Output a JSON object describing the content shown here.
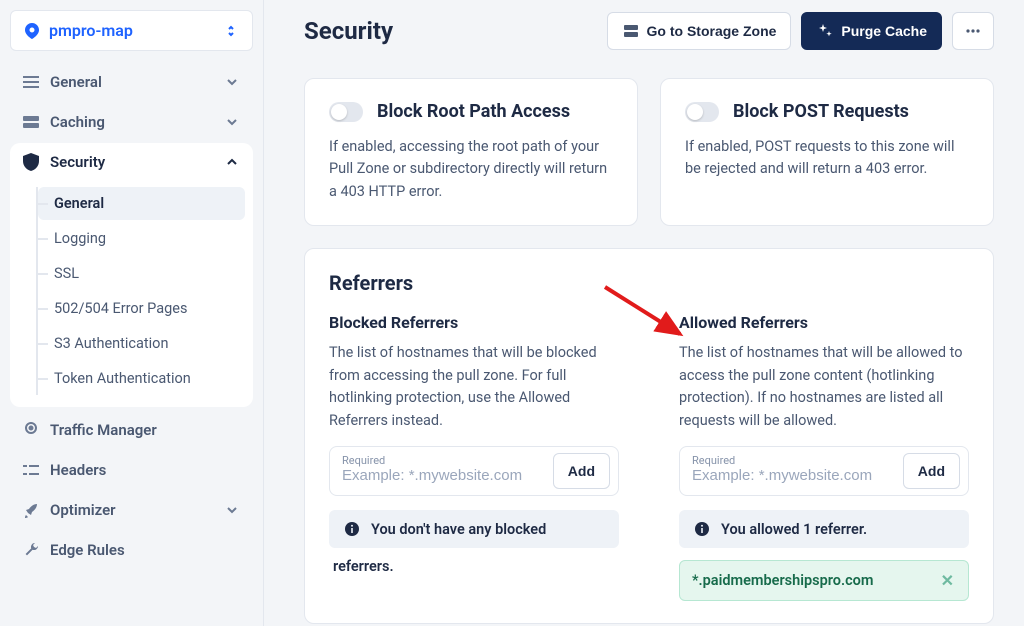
{
  "zone_name": "pmpro-map",
  "sidebar": {
    "general": "General",
    "caching": "Caching",
    "security": "Security",
    "security_sub": {
      "general": "General",
      "logging": "Logging",
      "ssl": "SSL",
      "error_pages": "502/504 Error Pages",
      "s3": "S3 Authentication",
      "token": "Token Authentication"
    },
    "traffic": "Traffic Manager",
    "headers": "Headers",
    "optimizer": "Optimizer",
    "edge_rules": "Edge Rules"
  },
  "header": {
    "title": "Security",
    "storage": "Go to Storage Zone",
    "purge": "Purge Cache"
  },
  "toggles": {
    "block_root": {
      "title": "Block Root Path Access",
      "desc": "If enabled, accessing the root path of your Pull Zone or subdirectory directly will return a 403 HTTP error."
    },
    "block_post": {
      "title": "Block POST Requests",
      "desc": "If enabled, POST requests to this zone will be rejected and will return a 403 error."
    }
  },
  "referrers": {
    "title": "Referrers",
    "blocked": {
      "title": "Blocked Referrers",
      "desc": "The list of hostnames that will be blocked from accessing the pull zone. For full hotlinking protection, use the Allowed Referrers instead.",
      "input_label": "Required",
      "placeholder": "Example: *.mywebsite.com",
      "add": "Add",
      "status_a": "You don't have any blocked",
      "status_b": "referrers."
    },
    "allowed": {
      "title": "Allowed Referrers",
      "desc": "The list of hostnames that will be allowed to access the pull zone content (hotlinking protection). If no hostnames are listed all requests will be allowed.",
      "input_label": "Required",
      "placeholder": "Example: *.mywebsite.com",
      "add": "Add",
      "status": "You allowed 1 referrer.",
      "items": [
        "*.paidmembershipspro.com"
      ]
    }
  }
}
